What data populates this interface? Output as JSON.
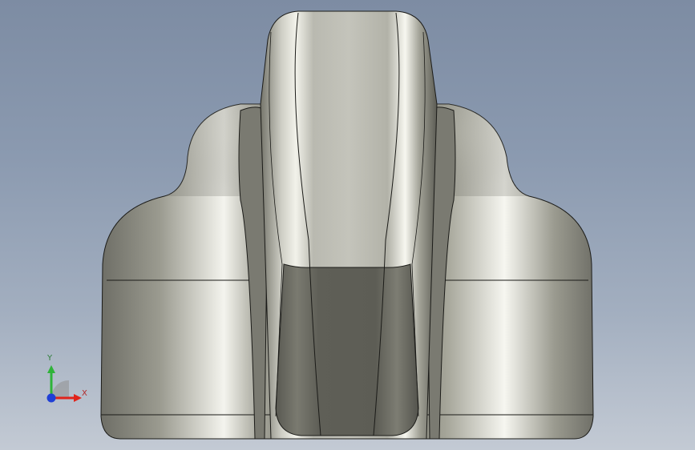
{
  "triad": {
    "y_label": "Y",
    "x_label": "X"
  },
  "colors": {
    "background_top": "#7d8ca3",
    "background_bottom": "#c3cad4",
    "model_metal": "#8e8e84",
    "x_axis": "#e0241b",
    "y_axis": "#2fb33a",
    "z_axis": "#1f3fd6"
  },
  "icons": {
    "origin": "orientation-triad-icon"
  }
}
